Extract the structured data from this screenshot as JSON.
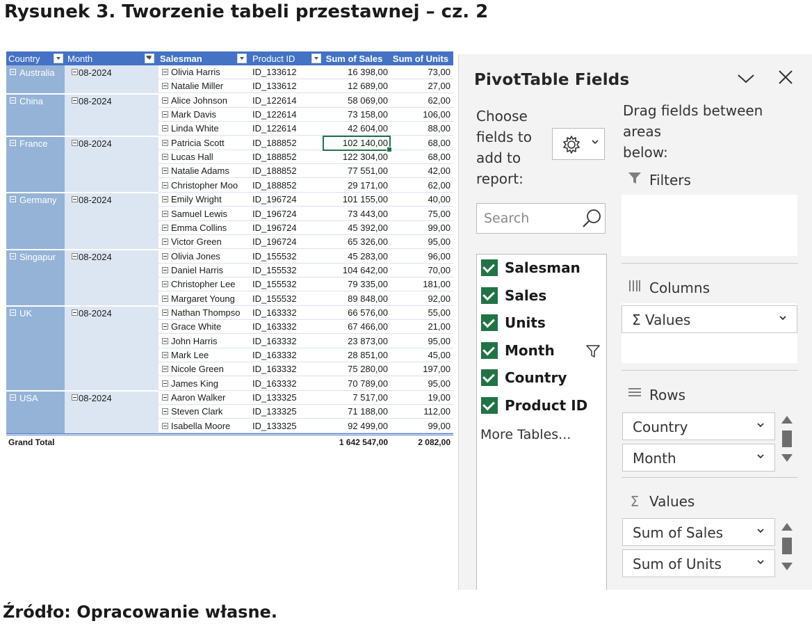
{
  "figure": {
    "title": "Rysunek 3. Tworzenie tabeli przestawnej – cz. 2",
    "source": "Źródło: Opracowanie własne."
  },
  "pivot": {
    "headers": [
      "Country",
      "Month",
      "Salesman",
      "Product ID",
      "Sum of Sales",
      "Sum of Units"
    ],
    "groups": [
      {
        "country": "Australia",
        "month": "08-2024",
        "rows": [
          {
            "salesman": "Olivia Harris",
            "product": "ID_133612",
            "sales": "16 398,00",
            "units": "73,00"
          },
          {
            "salesman": "Natalie Miller",
            "product": "ID_133612",
            "sales": "12 689,00",
            "units": "27,00"
          }
        ]
      },
      {
        "country": "China",
        "month": "08-2024",
        "rows": [
          {
            "salesman": "Alice Johnson",
            "product": "ID_122614",
            "sales": "58 069,00",
            "units": "62,00"
          },
          {
            "salesman": "Mark Davis",
            "product": "ID_122614",
            "sales": "73 158,00",
            "units": "106,00"
          },
          {
            "salesman": "Linda White",
            "product": "ID_122614",
            "sales": "42 604,00",
            "units": "88,00"
          }
        ]
      },
      {
        "country": "France",
        "month": "08-2024",
        "rows": [
          {
            "salesman": "Patricia Scott",
            "product": "ID_188852",
            "sales": "102 140,00",
            "units": "68,00"
          },
          {
            "salesman": "Lucas Hall",
            "product": "ID_188852",
            "sales": "122 304,00",
            "units": "68,00"
          },
          {
            "salesman": "Natalie Adams",
            "product": "ID_188852",
            "sales": "77 551,00",
            "units": "42,00"
          },
          {
            "salesman": "Christopher Moo",
            "product": "ID_188852",
            "sales": "29 171,00",
            "units": "62,00"
          }
        ]
      },
      {
        "country": "Germany",
        "month": "08-2024",
        "rows": [
          {
            "salesman": "Emily Wright",
            "product": "ID_196724",
            "sales": "101 155,00",
            "units": "40,00"
          },
          {
            "salesman": "Samuel Lewis",
            "product": "ID_196724",
            "sales": "73 443,00",
            "units": "75,00"
          },
          {
            "salesman": "Emma Collins",
            "product": "ID_196724",
            "sales": "45 392,00",
            "units": "99,00"
          },
          {
            "salesman": "Victor Green",
            "product": "ID_196724",
            "sales": "65 326,00",
            "units": "95,00"
          }
        ]
      },
      {
        "country": "Singapur",
        "month": "08-2024",
        "rows": [
          {
            "salesman": "Olivia Jones",
            "product": "ID_155532",
            "sales": "45 283,00",
            "units": "96,00"
          },
          {
            "salesman": "Daniel Harris",
            "product": "ID_155532",
            "sales": "104 642,00",
            "units": "70,00"
          },
          {
            "salesman": "Christopher Lee",
            "product": "ID_155532",
            "sales": "79 335,00",
            "units": "181,00"
          },
          {
            "salesman": "Margaret Young",
            "product": "ID_155532",
            "sales": "89 848,00",
            "units": "92,00"
          }
        ]
      },
      {
        "country": "UK",
        "month": "08-2024",
        "rows": [
          {
            "salesman": "Nathan Thompso",
            "product": "ID_163332",
            "sales": "66 576,00",
            "units": "55,00"
          },
          {
            "salesman": "Grace White",
            "product": "ID_163332",
            "sales": "67 466,00",
            "units": "21,00"
          },
          {
            "salesman": "John Harris",
            "product": "ID_163332",
            "sales": "23 873,00",
            "units": "95,00"
          },
          {
            "salesman": "Mark Lee",
            "product": "ID_163332",
            "sales": "28 851,00",
            "units": "45,00"
          },
          {
            "salesman": "Nicole Green",
            "product": "ID_163332",
            "sales": "75 280,00",
            "units": "197,00"
          },
          {
            "salesman": "James King",
            "product": "ID_163332",
            "sales": "70 789,00",
            "units": "95,00"
          }
        ]
      },
      {
        "country": "USA",
        "month": "08-2024",
        "rows": [
          {
            "salesman": "Aaron Walker",
            "product": "ID_133325",
            "sales": "7 517,00",
            "units": "19,00"
          },
          {
            "salesman": "Steven Clark",
            "product": "ID_133325",
            "sales": "71 188,00",
            "units": "112,00"
          },
          {
            "salesman": "Isabella Moore",
            "product": "ID_133325",
            "sales": "92 499,00",
            "units": "99,00"
          }
        ]
      }
    ],
    "grand_total": {
      "label": "Grand Total",
      "sales": "1 642 547,00",
      "units": "2 082,00"
    },
    "selected_cell": "102 140,00",
    "colors": {
      "header": "#4472c4",
      "country_band": "#95b3d7",
      "row_band": "#dce6f2",
      "selection": "#217346"
    }
  },
  "pane": {
    "title": "PivotTable Fields",
    "choose_lines": [
      "Choose",
      "fields to",
      "add to",
      "report:"
    ],
    "search_placeholder": "Search",
    "fields": [
      {
        "label": "Salesman",
        "checked": true,
        "filtered": false
      },
      {
        "label": "Sales",
        "checked": true,
        "filtered": false
      },
      {
        "label": "Units",
        "checked": true,
        "filtered": false
      },
      {
        "label": "Month",
        "checked": true,
        "filtered": true
      },
      {
        "label": "Country",
        "checked": true,
        "filtered": false
      },
      {
        "label": "Product ID",
        "checked": true,
        "filtered": false
      }
    ],
    "more_tables": "More Tables...",
    "drag_lines": [
      "Drag fields between areas",
      "below:"
    ],
    "areas": {
      "filters": {
        "label": "Filters",
        "icon": "filter-icon"
      },
      "columns": {
        "label": "Columns",
        "icon": "columns-icon",
        "items": [
          "Σ  Values"
        ]
      },
      "rows": {
        "label": "Rows",
        "icon": "rows-icon",
        "items": [
          "Country",
          "Month"
        ]
      },
      "values": {
        "label": "Values",
        "icon": "sigma-icon",
        "items": [
          "Sum of Sales",
          "Sum of Units"
        ]
      }
    }
  }
}
